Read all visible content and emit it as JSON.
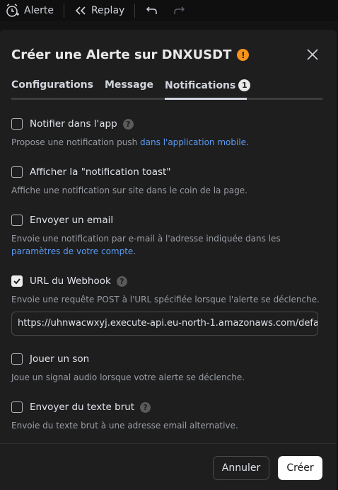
{
  "topbar": {
    "alert_label": "Alerte",
    "replay_label": "Replay",
    "icons": [
      "alarm-clock-plus-icon",
      "rewind-icon",
      "undo-icon",
      "redo-icon"
    ]
  },
  "dialog": {
    "title": "Créer une Alerte sur DNXUSDT",
    "warning_glyph": "!",
    "tabs": [
      {
        "label": "Configurations"
      },
      {
        "label": "Message"
      },
      {
        "label": "Notifications",
        "badge": "1"
      }
    ],
    "options": {
      "app": {
        "label": "Notifier dans l'app",
        "checked": false,
        "desc": "Propose une notification push ",
        "desc_link": "dans l'application mobile",
        "desc_end": "."
      },
      "toast": {
        "label": "Afficher la \"notification toast\"",
        "checked": false,
        "desc": "Affiche une notification sur site dans le coin de la page."
      },
      "email": {
        "label": "Envoyer un email",
        "checked": false,
        "desc": "Envoie une notification par e-mail à l'adresse indiquée dans les ",
        "desc_link": "paramètres de votre compte",
        "desc_end": "."
      },
      "webhook": {
        "label": "URL du Webhook",
        "checked": true,
        "desc": "Envoie une requête POST à l'URL spécifiée lorsque l'alerte se déclenche.",
        "url": "https://uhnwacwxyj.execute-api.eu-north-1.amazonaws.com/defa"
      },
      "sound": {
        "label": "Jouer un son",
        "checked": false,
        "desc": "Joue un signal audio lorsque votre alerte se déclenche."
      },
      "raw": {
        "label": "Envoyer du texte brut",
        "checked": false,
        "desc": "Envoie du texte brut à une adresse email alternative."
      }
    },
    "help_glyph": "?",
    "buttons": {
      "cancel": "Annuler",
      "create": "Créer"
    }
  },
  "colors": {
    "background": "#131313",
    "dialog": "#1e1e1e",
    "link": "#5b9cf6",
    "warning": "#f7931a"
  }
}
